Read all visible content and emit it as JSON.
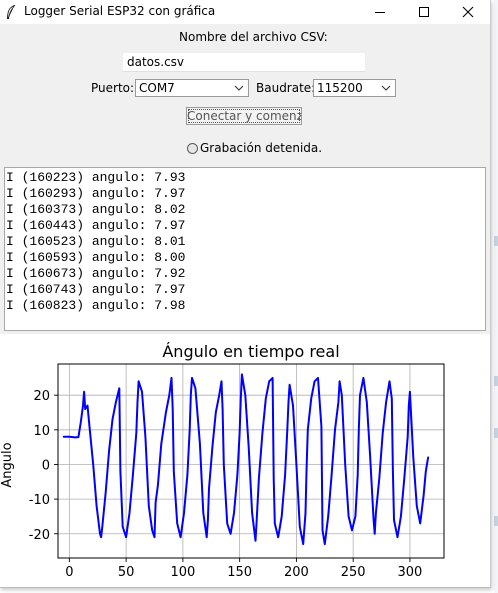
{
  "window": {
    "title": "Logger Serial ESP32 con gráfica"
  },
  "form": {
    "filename_label": "Nombre del archivo CSV:",
    "filename_value": "datos.csv",
    "port_label": "Puerto:",
    "port_value": "COM7",
    "baud_label": "Baudrate:",
    "baud_value": "115200",
    "connect_button": "Conectar y comenzar",
    "status_text": "Grabación detenida."
  },
  "log": {
    "lines": [
      "I (160223) angulo: 7.93",
      "I (160293) angulo: 7.97",
      "I (160373) angulo: 8.02",
      "I (160443) angulo: 7.97",
      "I (160523) angulo: 8.01",
      "I (160593) angulo: 8.00",
      "I (160673) angulo: 7.92",
      "I (160743) angulo: 7.97",
      "I (160823) angulo: 7.98"
    ]
  },
  "chart_data": {
    "type": "line",
    "title": "Ángulo en tiempo real",
    "xlabel": "",
    "ylabel": "Angulo",
    "xlim": [
      -10,
      330
    ],
    "ylim": [
      -27,
      29
    ],
    "xticks": [
      0,
      50,
      100,
      150,
      200,
      250,
      300
    ],
    "yticks": [
      -20,
      -10,
      0,
      10,
      20
    ],
    "grid": true,
    "series": [
      {
        "color": "#0000ff",
        "x": [
          -5,
          0,
          5,
          8,
          10,
          12,
          13,
          14,
          16,
          18,
          21,
          24,
          27,
          28,
          29,
          32,
          35,
          38,
          41,
          44,
          45,
          47,
          50,
          53,
          56,
          59,
          60,
          61,
          64,
          67,
          70,
          73,
          75,
          76,
          78,
          81,
          85,
          88,
          90,
          91,
          92,
          95,
          98,
          101,
          104,
          106,
          107,
          108,
          111,
          115,
          118,
          121,
          122,
          123,
          126,
          129,
          132,
          134,
          135,
          136,
          139,
          142,
          145,
          148,
          150,
          151,
          152,
          155,
          158,
          161,
          164,
          165,
          167,
          170,
          173,
          176,
          179,
          180,
          181,
          184,
          187,
          190,
          192,
          193,
          194,
          197,
          200,
          203,
          206,
          208,
          209,
          210,
          213,
          216,
          219,
          222,
          223,
          225,
          228,
          231,
          234,
          237,
          238,
          240,
          243,
          246,
          249,
          252,
          254,
          255,
          256,
          259,
          262,
          265,
          268,
          269,
          270,
          273,
          276,
          279,
          282,
          284,
          285,
          286,
          289,
          292,
          295,
          298,
          299,
          300,
          303,
          306,
          309,
          312,
          314,
          316
        ],
        "y": [
          8,
          8,
          7.8,
          7.9,
          12,
          17,
          21,
          16,
          17,
          10,
          0,
          -12,
          -20,
          -21,
          -18,
          -8,
          4,
          13,
          18,
          22,
          -2,
          -18,
          -21,
          -14,
          -3,
          9,
          18,
          24,
          21,
          8,
          -12,
          -19,
          -21,
          -11,
          -6,
          6,
          15,
          20,
          25,
          16,
          -2,
          -17,
          -21,
          -14,
          -3,
          10,
          20,
          25,
          22,
          6,
          -14,
          -21,
          -16,
          -7,
          5,
          15,
          20,
          24,
          16,
          0,
          -17,
          -20,
          -14,
          -3,
          9,
          19,
          26,
          20,
          5,
          -14,
          -22,
          -16,
          -4,
          9,
          19,
          24,
          25,
          -4,
          -17,
          -21,
          -15,
          -3,
          10,
          18,
          23,
          17,
          0,
          -18,
          -23,
          -14,
          -1,
          10,
          19,
          24,
          25,
          11,
          -19,
          -23,
          -15,
          -3,
          10,
          18,
          24,
          20,
          0,
          -15,
          -19,
          -15,
          -3,
          11,
          20,
          25,
          18,
          2,
          -16,
          -20,
          -14,
          -4,
          9,
          18,
          24,
          19,
          -2,
          -16,
          -21,
          -15,
          -4,
          8,
          17,
          21,
          2,
          -12,
          -17,
          -9,
          -2,
          2
        ]
      }
    ]
  }
}
